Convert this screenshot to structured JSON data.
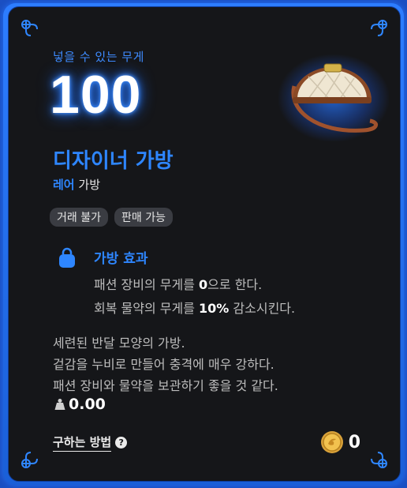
{
  "tooltip": {
    "weight_label": "넣을 수 있는 무게",
    "weight_value": "100",
    "item_name": "디자이너 가방",
    "rarity": "레어",
    "category": "가방",
    "tags": [
      "거래 불가",
      "판매 가능"
    ],
    "effect": {
      "title": "가방 효과",
      "line1_pre": "패션 장비의 무게를 ",
      "line1_bold": "0",
      "line1_post": "으로 한다.",
      "line2_pre": "회복 물약의 무게를 ",
      "line2_bold": "10%",
      "line2_post": " 감소시킨다."
    },
    "description": [
      "세련된 반달 모양의 가방.",
      "겉감을 누비로 만들어 충격에 매우 강하다.",
      "패션 장비와 물약을 보관하기 좋을 것 같다."
    ],
    "durability": "0.00",
    "how_to_obtain": "구하는 방법",
    "price": "0",
    "icons": [
      "bag-effect-icon",
      "weight-icon",
      "help-icon",
      "gold-coin-icon",
      "designer-bag-image"
    ],
    "colors": {
      "accent": "#2e86ff",
      "frame": "#1b4fc2",
      "background": "#151619",
      "tag_bg": "#3a3c42"
    }
  }
}
